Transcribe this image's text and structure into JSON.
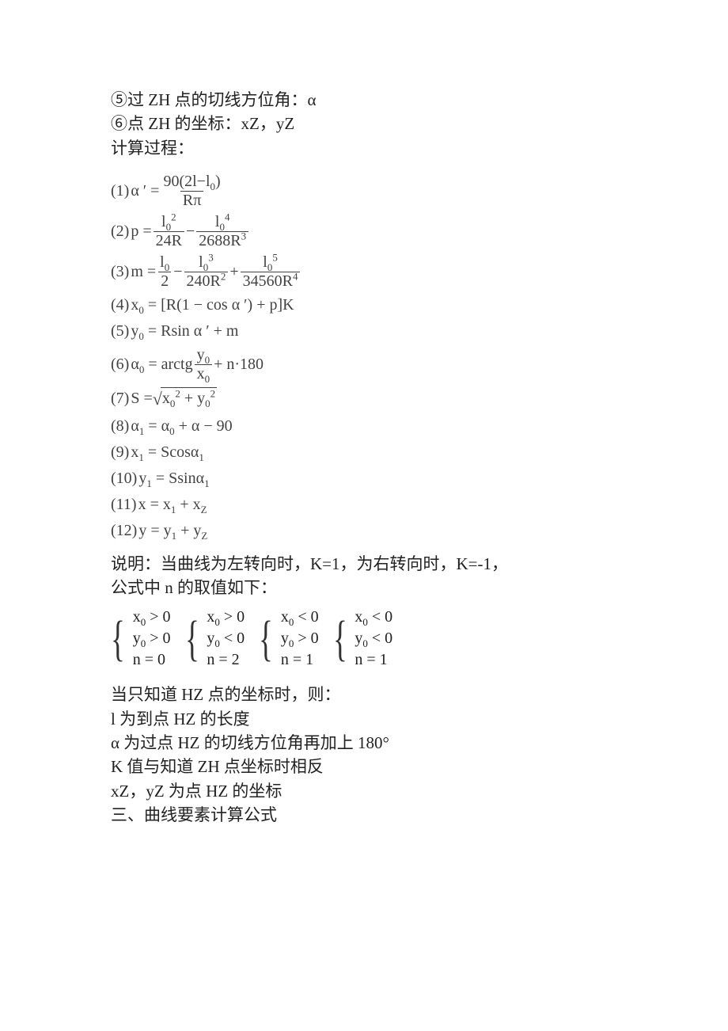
{
  "lines": {
    "l1": "⑤过 ZH 点的切线方位角：α",
    "l2": "⑥点 ZH 的坐标：xZ，yZ",
    "l3": "计算过程：",
    "explain1": "说明：当曲线为左转向时，K=1，为右转向时，K=-1，",
    "explain2": "公式中 n 的取值如下：",
    "after1": "当只知道 HZ 点的坐标时，则：",
    "after2": "l 为到点 HZ 的长度",
    "after3": "α 为过点 HZ 的切线方位角再加上 180°",
    "after4": "K 值与知道 ZH 点坐标时相反",
    "after5": "xZ，yZ 为点 HZ 的坐标",
    "after6": "三、曲线要素计算公式"
  },
  "formulas": {
    "f1": {
      "idx": "(1)",
      "lhs": "α ′ =",
      "num": "90(2l−l",
      "num_sub": "0",
      "num_tail": ")",
      "den": "Rπ"
    },
    "f2": {
      "idx": "(2)",
      "lhs": "p =",
      "t1_num_base": "l",
      "t1_num_sub": "0",
      "t1_num_sup": "2",
      "t1_den": "24R",
      "t2_num_base": "l",
      "t2_num_sub": "0",
      "t2_num_sup": "4",
      "t2_den_base": "2688R",
      "t2_den_sup": "3"
    },
    "f3": {
      "idx": "(3)",
      "lhs": "m =",
      "a_num_base": "l",
      "a_num_sub": "0",
      "a_den": "2",
      "b_num_base": "l",
      "b_num_sub": "0",
      "b_num_sup": "3",
      "b_den_base": "240R",
      "b_den_sup": "2",
      "c_num_base": "l",
      "c_num_sub": "0",
      "c_num_sup": "5",
      "c_den_base": "34560R",
      "c_den_sup": "4"
    },
    "f4": {
      "idx": "(4)",
      "body_a": "x",
      "sub_a": "0",
      "body_b": " = [R(1 − cos α ′) + p]K"
    },
    "f5": {
      "idx": "(5)",
      "body_a": "y",
      "sub_a": "0",
      "body_b": " = Rsin α ′ + m"
    },
    "f6": {
      "idx": "(6)",
      "lhs_a": "α",
      "lhs_sub": "0",
      "lhs_b": " = arctg",
      "num_a": "y",
      "num_sub": "0",
      "den_a": "x",
      "den_sub": "0",
      "tail": " + n·180"
    },
    "f7": {
      "idx": "(7)",
      "lhs": "S = ",
      "rx": "x",
      "rx_sub": "0",
      "rx_sup": "2",
      "plus": " + ",
      "ry": "y",
      "ry_sub": "0",
      "ry_sup": "2"
    },
    "f8": {
      "idx": "(8)",
      "a": "α",
      "as": "1",
      "eq": " = ",
      "b": "α",
      "bs": "0",
      "tail": " + α − 90"
    },
    "f9": {
      "idx": "(9)",
      "a": "x",
      "as": "1",
      "eq": " = Scos",
      "b": "α",
      "bs": "1"
    },
    "f10": {
      "idx": "(10)",
      "a": "y",
      "as": "1",
      "eq": " = Ssin",
      "b": "α",
      "bs": "1"
    },
    "f11": {
      "idx": "(11)",
      "body": "x = ",
      "a": "x",
      "as": "1",
      "plus": " + ",
      "b": "x",
      "bs": "Z"
    },
    "f12": {
      "idx": "(12)",
      "body": "y = ",
      "a": "y",
      "as": "1",
      "plus": " + ",
      "b": "y",
      "bs": "Z"
    }
  },
  "cases": [
    {
      "x": "x",
      "xs": "0",
      "xop": " > 0",
      "y": "y",
      "ys": "0",
      "yop": " > 0",
      "n": "n = 0"
    },
    {
      "x": "x",
      "xs": "0",
      "xop": " > 0",
      "y": "y",
      "ys": "0",
      "yop": " < 0",
      "n": "n = 2"
    },
    {
      "x": "x",
      "xs": "0",
      "xop": " < 0",
      "y": "y",
      "ys": "0",
      "yop": " > 0",
      "n": "n = 1"
    },
    {
      "x": "x",
      "xs": "0",
      "xop": " < 0",
      "y": "y",
      "ys": "0",
      "yop": " < 0",
      "n": "n = 1"
    }
  ]
}
